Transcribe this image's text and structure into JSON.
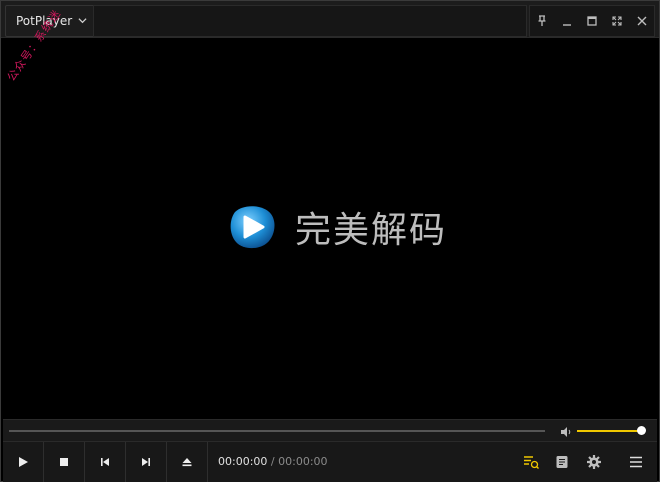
{
  "app": {
    "title": "PotPlayer",
    "dropdown_icon": "chevron-down-icon"
  },
  "window_controls": [
    "pin-icon",
    "minimize-icon",
    "maximize-icon",
    "fullscreen-icon",
    "close-icon"
  ],
  "watermark": "公众号：系统迷",
  "splash": {
    "text": "完美解码",
    "logo_icon": "play-logo-icon"
  },
  "playback": {
    "current_time": "00:00:00",
    "separator": "/",
    "duration": "00:00:00",
    "progress": 0,
    "volume": 1.0
  },
  "colors": {
    "accent": "#f0c800",
    "background": "#000000",
    "bar": "#181818",
    "logo_blue": "#1e8fd6"
  },
  "controls": [
    "play-icon",
    "stop-icon",
    "previous-icon",
    "next-icon",
    "eject-icon"
  ],
  "right_controls": [
    "playlist-icon",
    "chapters-icon",
    "settings-icon",
    "menu-icon"
  ]
}
